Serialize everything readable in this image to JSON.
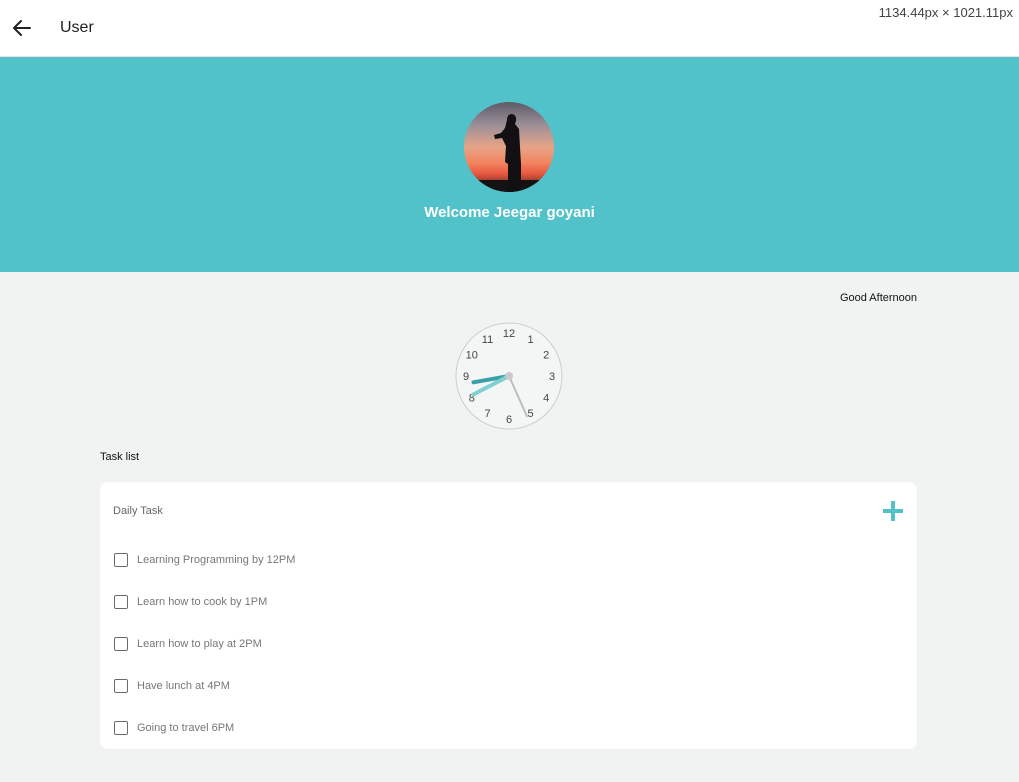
{
  "header": {
    "title": "User",
    "back_icon": "arrow-left-icon",
    "dimensions_text": "1134.44px × 1021.11px"
  },
  "profile": {
    "welcome_text": "Welcome Jeegar goyani",
    "avatar_icon": "photographer-silhouette-avatar"
  },
  "colors": {
    "accent": "#52c2ca",
    "hour_hand": "#3a9fa6",
    "minute_hand": "#7fcfd3",
    "second_hand": "#bdbdbd"
  },
  "greeting": "Good Afternoon",
  "clock": {
    "numbers": [
      "12",
      "1",
      "2",
      "3",
      "4",
      "5",
      "6",
      "7",
      "8",
      "9",
      "10",
      "11"
    ],
    "hour": 8,
    "minute": 40,
    "second": 26
  },
  "tasks": {
    "section_label": "Task list",
    "card_title": "Daily Task",
    "add_icon": "plus-icon",
    "items": [
      {
        "label": "Learning Programming by 12PM",
        "checked": false
      },
      {
        "label": "Learn how to cook by 1PM",
        "checked": false
      },
      {
        "label": "Learn how to play at 2PM",
        "checked": false
      },
      {
        "label": "Have lunch at 4PM",
        "checked": false
      },
      {
        "label": "Going to travel 6PM",
        "checked": false
      }
    ]
  }
}
